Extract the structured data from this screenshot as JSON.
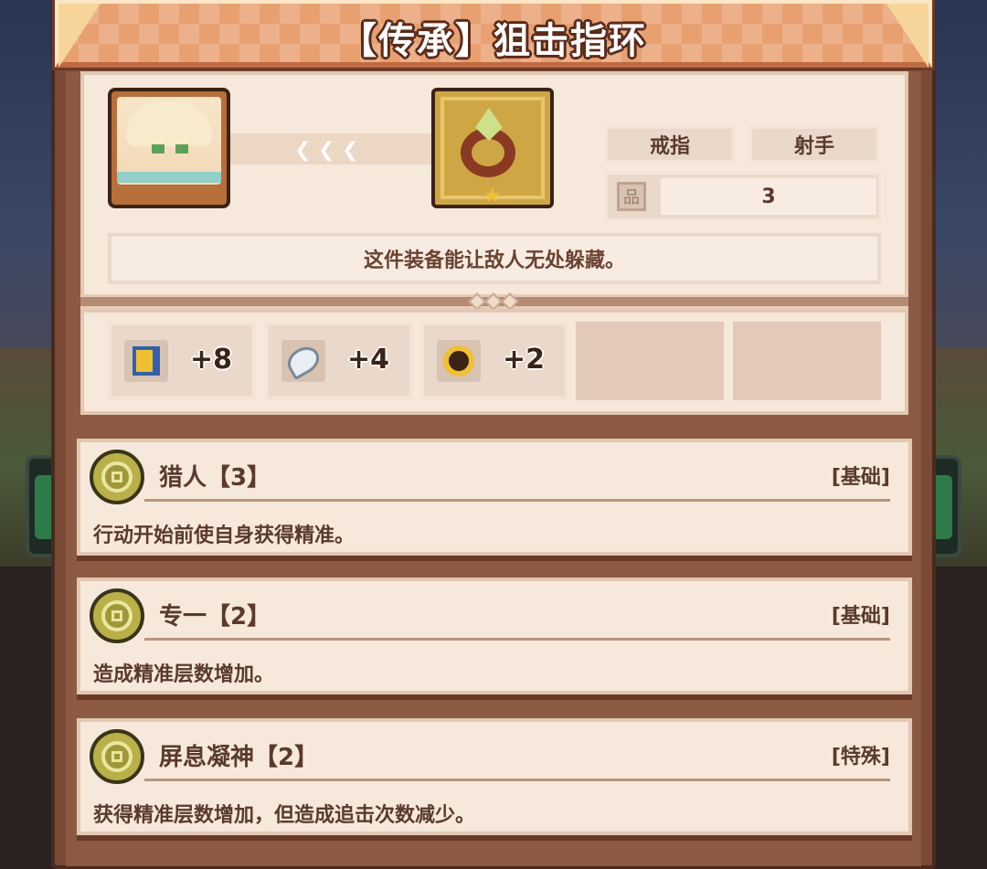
{
  "title": "【传承】狙击指环",
  "item": {
    "tags": [
      "戒指",
      "射手"
    ],
    "stack_value": "3",
    "description": "这件装备能让敌人无处躲藏。"
  },
  "stats": [
    {
      "icon": "boot-icon",
      "value": "+8"
    },
    {
      "icon": "feather-icon",
      "value": "+4"
    },
    {
      "icon": "medal-icon",
      "value": "+2"
    }
  ],
  "traits": [
    {
      "name": "猎人【3】",
      "kind": "[基础]",
      "text": "行动开始前使自身获得精准。"
    },
    {
      "name": "专一【2】",
      "kind": "[基础]",
      "text": "造成精准层数增加。"
    },
    {
      "name": "屏息凝神【2】",
      "kind": "[特殊]",
      "text": "获得精准层数增加，但造成追击次数减少。"
    }
  ],
  "colors": {
    "panel": "#7a4a36",
    "card": "#f6e8da",
    "title_banner": "#e8a070",
    "text": "#5a3a2e"
  }
}
